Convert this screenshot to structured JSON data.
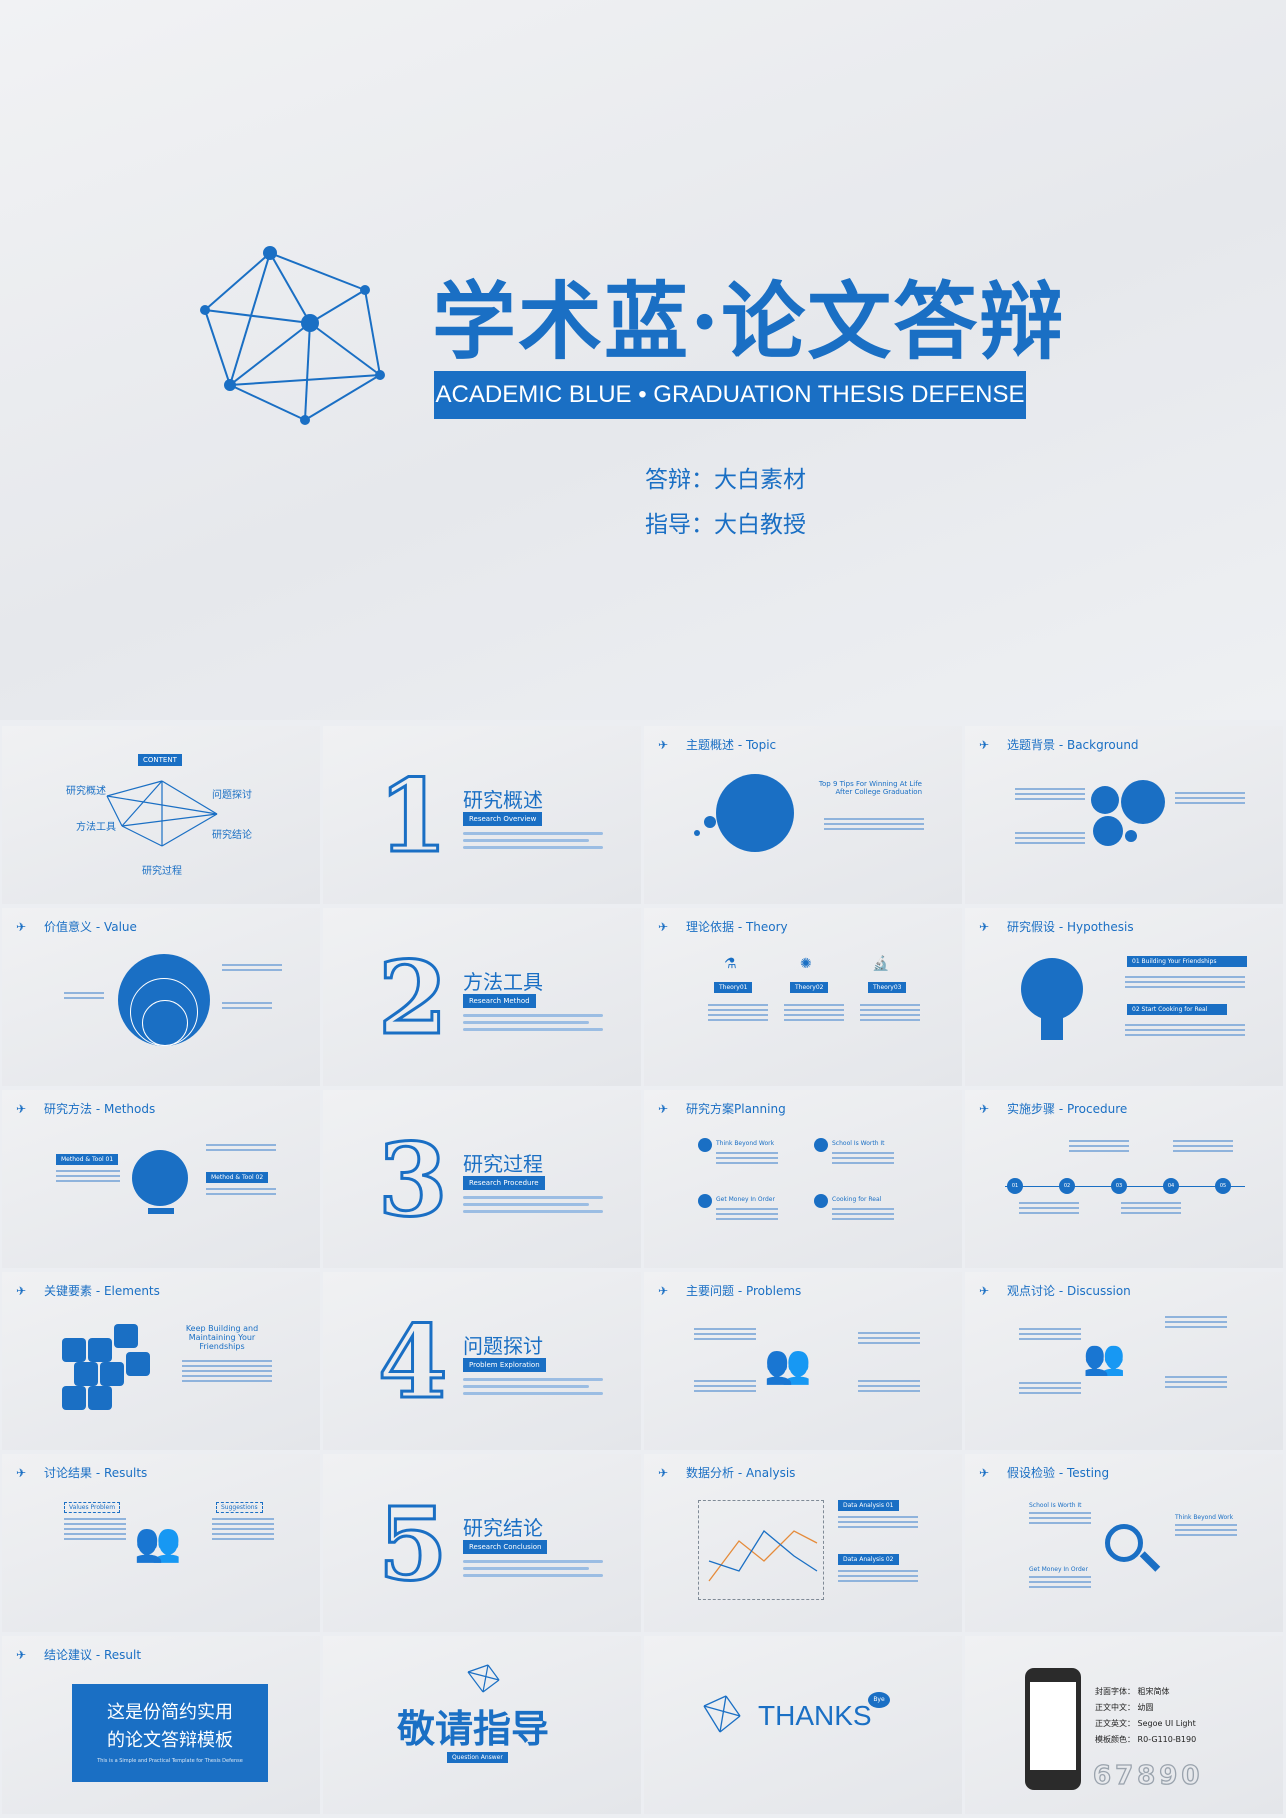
{
  "cover": {
    "title": "学术蓝·论文答辩",
    "subtitle": "ACADEMIC BLUE • GRADUATION THESIS DEFENSE",
    "defender": "答辩：大白素材",
    "advisor": "指导：大白教授"
  },
  "toc": {
    "tag": "CONTENT",
    "items": [
      {
        "label": "研究概述",
        "sub": "Research Overview"
      },
      {
        "label": "方法工具",
        "sub": "Research Method"
      },
      {
        "label": "研究过程",
        "sub": "Research Procedure"
      },
      {
        "label": "研究结论",
        "sub": "Research Conclusion"
      },
      {
        "label": "问题探讨",
        "sub": "Problem Exploration"
      }
    ]
  },
  "sections": [
    {
      "num": "1",
      "title": "研究概述",
      "sub": "Research Overview"
    },
    {
      "num": "2",
      "title": "方法工具",
      "sub": "Research Method"
    },
    {
      "num": "3",
      "title": "研究过程",
      "sub": "Research Procedure"
    },
    {
      "num": "4",
      "title": "问题探讨",
      "sub": "Problem Exploration"
    },
    {
      "num": "5",
      "title": "研究结论",
      "sub": "Research Conclusion"
    }
  ],
  "slide_headers": {
    "topic": "主题概述 - Topic",
    "background": "选题背景 - Background",
    "value": "价值意义 - Value",
    "theory": "理论依据 - Theory",
    "hypothesis": "研究假设 - Hypothesis",
    "methods": "研究方法 - Methods",
    "planning": "研究方案Planning",
    "procedure": "实施步骤 - Procedure",
    "elements": "关键要素 - Elements",
    "problems": "主要问题 - Problems",
    "discussion": "观点讨论 - Discussion",
    "results": "讨论结果 - Results",
    "analysis": "数据分析 - Analysis",
    "testing": "假设检验 - Testing",
    "result": "结论建议 - Result"
  },
  "topic": {
    "quote": "Top 9 Tips For Winning At Life After College Graduation"
  },
  "theory": {
    "tags": [
      "Theory01",
      "Theory02",
      "Theory03"
    ]
  },
  "hypothesis": {
    "tags": [
      "01 Building Your Friendships",
      "02 Start Cooking for Real"
    ]
  },
  "methods": {
    "tags": [
      "Method & Tool 01",
      "Method & Tool 02"
    ]
  },
  "planning": {
    "items": [
      "Think Beyond Work",
      "School Is Worth It",
      "Get Money In Order",
      "Cooking for Real"
    ]
  },
  "procedure": {
    "steps": [
      "01",
      "02",
      "03",
      "04",
      "05"
    ]
  },
  "elements": {
    "text": "Keep Building and Maintaining Your Friendships"
  },
  "results": {
    "tags": [
      "Values Problem",
      "Suggestions"
    ]
  },
  "analysis": {
    "tags": [
      "Data Analysis 01",
      "Data Analysis 02"
    ]
  },
  "testing": {
    "labels": [
      "School Is Worth It",
      "Think Beyond Work",
      "Get Money In Order"
    ]
  },
  "result_box": {
    "line1": "这是份简约实用",
    "line2": "的论文答辩模板",
    "line3": "This is a Simple and Practical Template for Thesis Defense"
  },
  "thanks_slide": {
    "title": "敬请指导",
    "sub": "Question Answer"
  },
  "thanks": {
    "text": "THANKS",
    "bubble": "Bye"
  },
  "specs": {
    "items": [
      "封面字体：  粗宋简体",
      "正文中文：  幼圆",
      "正文英文：  Segoe UI Light",
      "模板颜色：  R0-G110-B190"
    ],
    "digits": "67890"
  }
}
